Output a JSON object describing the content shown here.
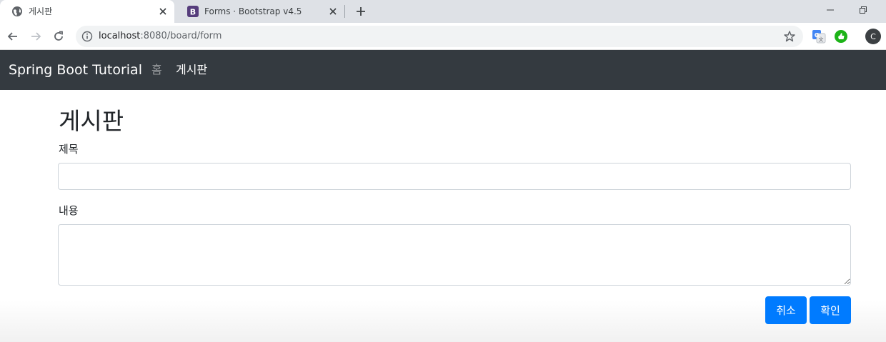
{
  "browser": {
    "tabs": [
      {
        "title": "게시판",
        "active": true
      },
      {
        "title": "Forms · Bootstrap v4.5",
        "active": false
      }
    ],
    "url": {
      "host": "localhost",
      "path": ":8080/board/form"
    },
    "profile_initial": "C",
    "colors": {
      "tabstrip": "#dee1e6",
      "omnibox": "#f1f3f4"
    }
  },
  "navbar": {
    "brand": "Spring Boot Tutorial",
    "links": [
      {
        "label": "홈",
        "active": false
      },
      {
        "label": "게시판",
        "active": true
      }
    ],
    "colors": {
      "background": "#343a40"
    }
  },
  "form": {
    "heading": "게시판",
    "title_label": "제목",
    "title_value": "",
    "content_label": "내용",
    "content_value": "",
    "cancel_label": "취소",
    "confirm_label": "확인",
    "colors": {
      "primary": "#007bff"
    }
  }
}
